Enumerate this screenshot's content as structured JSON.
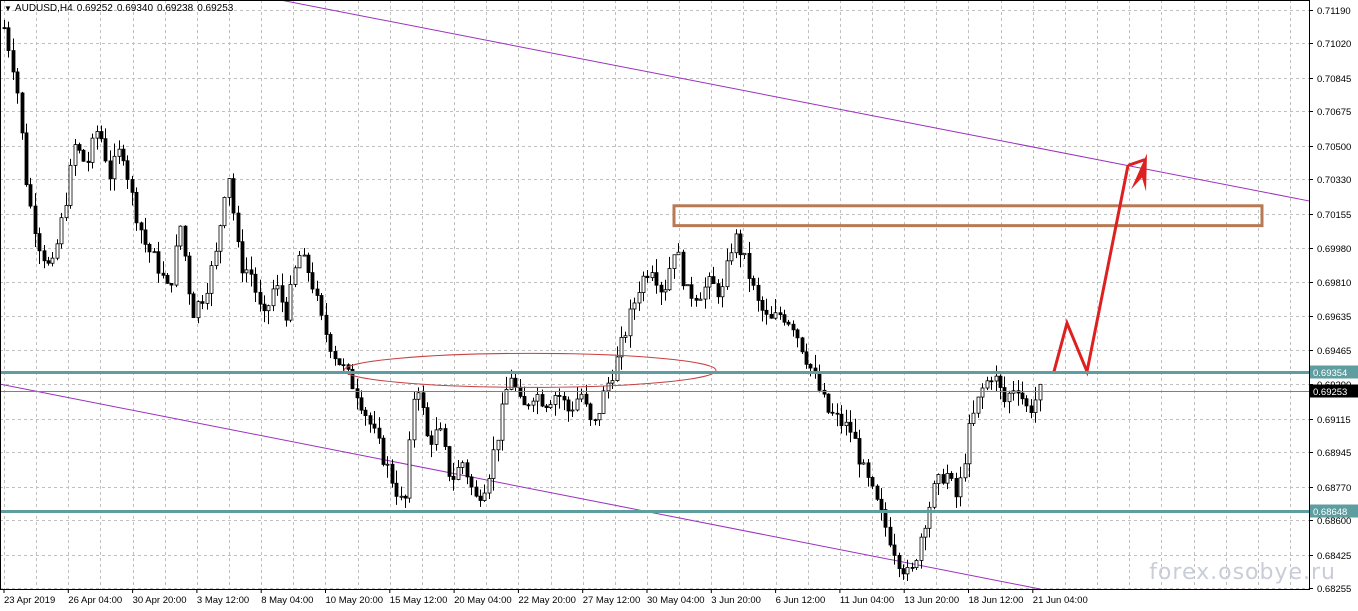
{
  "header": {
    "dropdown_icon": "triangle-down-icon",
    "symbol": "AUDUSD,H4",
    "open": "0.69252",
    "high": "0.69340",
    "low": "0.69238",
    "close": "0.69253"
  },
  "watermark": "forex.osobye.ru",
  "colors": {
    "background": "#ffffff",
    "grid": "#c0c0c0",
    "candle": "#000000",
    "channel": "#9b30c0",
    "level_line": "#5f9ea0",
    "zone_box": "#b87a55",
    "ellipse": "#c84040",
    "projection_arrow": "#dd2020",
    "price_tag_bg": "#000000",
    "level_tag_bg": "#5f9ea0"
  },
  "chart_data": {
    "type": "candlestick",
    "symbol": "AUDUSD",
    "timeframe": "H4",
    "ylim": [
      0.6825,
      0.7124
    ],
    "y_ticks": [
      "0.71190",
      "0.71020",
      "0.70845",
      "0.70675",
      "0.70500",
      "0.70330",
      "0.70155",
      "0.69980",
      "0.69810",
      "0.69635",
      "0.69465",
      "0.69290",
      "0.69115",
      "0.68945",
      "0.68770",
      "0.68600",
      "0.68425",
      "0.68255"
    ],
    "x_labels": [
      "23 Apr 2019",
      "26 Apr 04:00",
      "30 Apr 20:00",
      "3 May 12:00",
      "8 May 04:00",
      "10 May 20:00",
      "15 May 12:00",
      "20 May 04:00",
      "22 May 20:00",
      "27 May 12:00",
      "30 May 04:00",
      "3 Jun 20:00",
      "6 Jun 12:00",
      "11 Jun 04:00",
      "13 Jun 20:00",
      "18 Jun 12:00",
      "21 Jun 04:00"
    ],
    "current_price": "0.69253",
    "price_path": [
      0.711,
      0.7085,
      0.7025,
      0.7,
      0.6985,
      0.7015,
      0.705,
      0.704,
      0.706,
      0.7035,
      0.705,
      0.702,
      0.7,
      0.699,
      0.6975,
      0.701,
      0.6965,
      0.6975,
      0.6995,
      0.704,
      0.699,
      0.6985,
      0.696,
      0.698,
      0.6965,
      0.6995,
      0.6985,
      0.696,
      0.6945,
      0.6935,
      0.6925,
      0.691,
      0.6895,
      0.688,
      0.6865,
      0.6935,
      0.69,
      0.6905,
      0.688,
      0.689,
      0.687,
      0.688,
      0.6905,
      0.6935,
      0.6915,
      0.6925,
      0.692,
      0.6925,
      0.6915,
      0.6925,
      0.6905,
      0.6925,
      0.694,
      0.696,
      0.698,
      0.699,
      0.6975,
      0.7,
      0.6975,
      0.6975,
      0.698,
      0.6975,
      0.7005,
      0.699,
      0.697,
      0.696,
      0.6965,
      0.696,
      0.6945,
      0.693,
      0.6915,
      0.691,
      0.6905,
      0.6885,
      0.687,
      0.6855,
      0.684,
      0.683,
      0.6855,
      0.6875,
      0.6885,
      0.687,
      0.6905,
      0.6925,
      0.6935,
      0.692,
      0.693,
      0.6915,
      0.6925
    ],
    "levels": [
      {
        "label": "0.69354",
        "price": 0.69354
      },
      {
        "label": "0.68648",
        "price": 0.68648
      }
    ],
    "resistance_zone": {
      "from": 0.7012,
      "to": 0.7017
    },
    "channel_upper": {
      "start": 0.7129,
      "end": 0.7022
    },
    "channel_lower": {
      "start": 0.6929,
      "end": 0.6825
    },
    "ellipse_center": 0.6936,
    "projection": [
      0.69354,
      0.696,
      0.69354,
      0.704
    ],
    "arrow_tip": 0.7043,
    "series": [
      {
        "name": "AUDUSD,H4"
      }
    ]
  }
}
